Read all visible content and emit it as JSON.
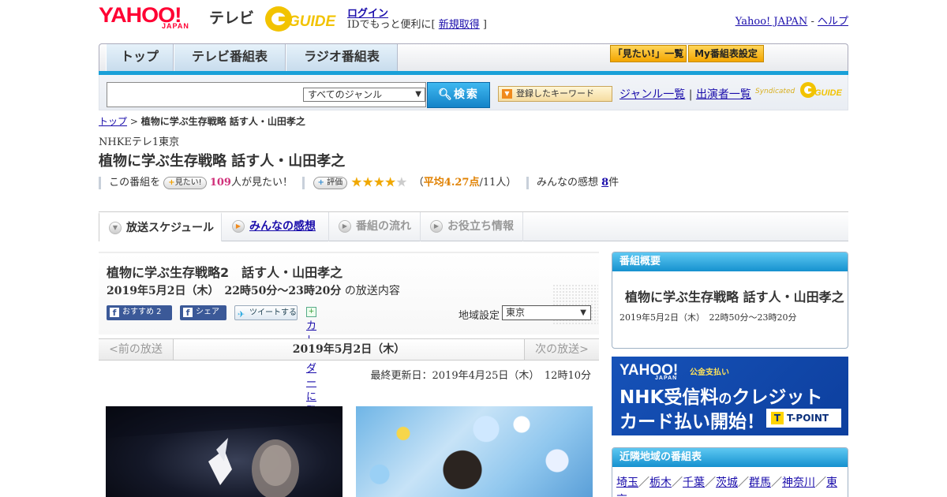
{
  "header": {
    "logo_yahoo": "YAHOO!",
    "logo_japan": "JAPAN",
    "logo_tv": "テレビ",
    "logo_gguide": "GUIDE",
    "login_label": "ログイン",
    "login_sub_prefix": "IDでもっと便利に[ ",
    "signup_label": "新規取得",
    "login_sub_suffix": " ]",
    "yahoo_japan_link": "Yahoo! JAPAN",
    "separator": " - ",
    "help_link": "ヘルプ"
  },
  "nav": {
    "tabs": [
      "トップ",
      "テレビ番組表",
      "ラジオ番組表"
    ],
    "want_list": "「見たい!」一覧",
    "my_schedule": "My番組表設定"
  },
  "search": {
    "placeholder": "",
    "genre_value": "すべてのジャンル",
    "button_label": "検索",
    "keyword_button": "登録したキーワード",
    "genre_list_link": "ジャンル一覧",
    "pipe": "|",
    "cast_list_link": "出演者一覧",
    "syndicated": "Syndicated",
    "gguide_small": "GUIDE"
  },
  "breadcrumb": {
    "top": "トップ",
    "sep": " > ",
    "current": "植物に学ぶ生存戦略 話す人・山田孝之"
  },
  "program": {
    "channel": "NHKEテレ1東京",
    "title": "植物に学ぶ生存戦略 話す人・山田孝之",
    "want_prefix": "この番組を",
    "want_button": "見たい!",
    "want_count": "109",
    "want_suffix": "人が見たい！",
    "rate_button": "評価",
    "rating": 4.27,
    "rating_open": "（",
    "rating_avg": "平均4.27点",
    "rating_people": "/11人）",
    "impressions_label": "みんなの感想",
    "impressions_count": "8",
    "impressions_unit": "件"
  },
  "tabs": [
    {
      "label": "放送スケジュール",
      "state": "active"
    },
    {
      "label": "みんなの感想",
      "state": "link"
    },
    {
      "label": "番組の流れ",
      "state": "disabled"
    },
    {
      "label": "お役立ち情報",
      "state": "disabled"
    }
  ],
  "episode": {
    "title": "植物に学ぶ生存戦略2　話す人・山田孝之",
    "date_time": "2019年5月2日（木）　22時50分～23時20分",
    "date_suffix": "の放送内容",
    "fb_recommend": "おすすめ 2",
    "fb_share": "シェア",
    "tweet": "ツイートする",
    "calendar": "カレンダーに登録",
    "region_label": "地域設定",
    "region_value": "東京"
  },
  "pager": {
    "prev": "<前の放送",
    "current": "2019年5月2日（木）",
    "next": "次の放送>"
  },
  "updated": "最終更新日：2019年4月25日（木）　12時10分",
  "sidebar": {
    "summary_head": "番組概要",
    "summary_title": "植物に学ぶ生存戦略 話す人・山田孝之",
    "summary_date": "2019年5月2日（木）　22時50分～23時20分",
    "ad_logo": "YAHOO!",
    "ad_logo_japan": "JAPAN",
    "ad_logo_sub": "公金支払い",
    "ad_line1_a": "NHK受信料",
    "ad_line1_b": "の",
    "ad_line1_c": "クレジット",
    "ad_line2": "カード払い開始！",
    "ad_tpoint": "T-POINT",
    "ad_tpoint_t": "T",
    "nearby_head": "近隣地域の番組表",
    "nearby": [
      "埼玉",
      "栃木",
      "千葉",
      "茨城",
      "群馬",
      "神奈川",
      "東京"
    ],
    "nearby_sep": "／"
  },
  "colors": {
    "accent_blue": "#1aa0d8",
    "link": "#1a0dab",
    "yahoo_red": "#ff0033",
    "star": "#f0a800",
    "want_pink": "#d0307a"
  }
}
